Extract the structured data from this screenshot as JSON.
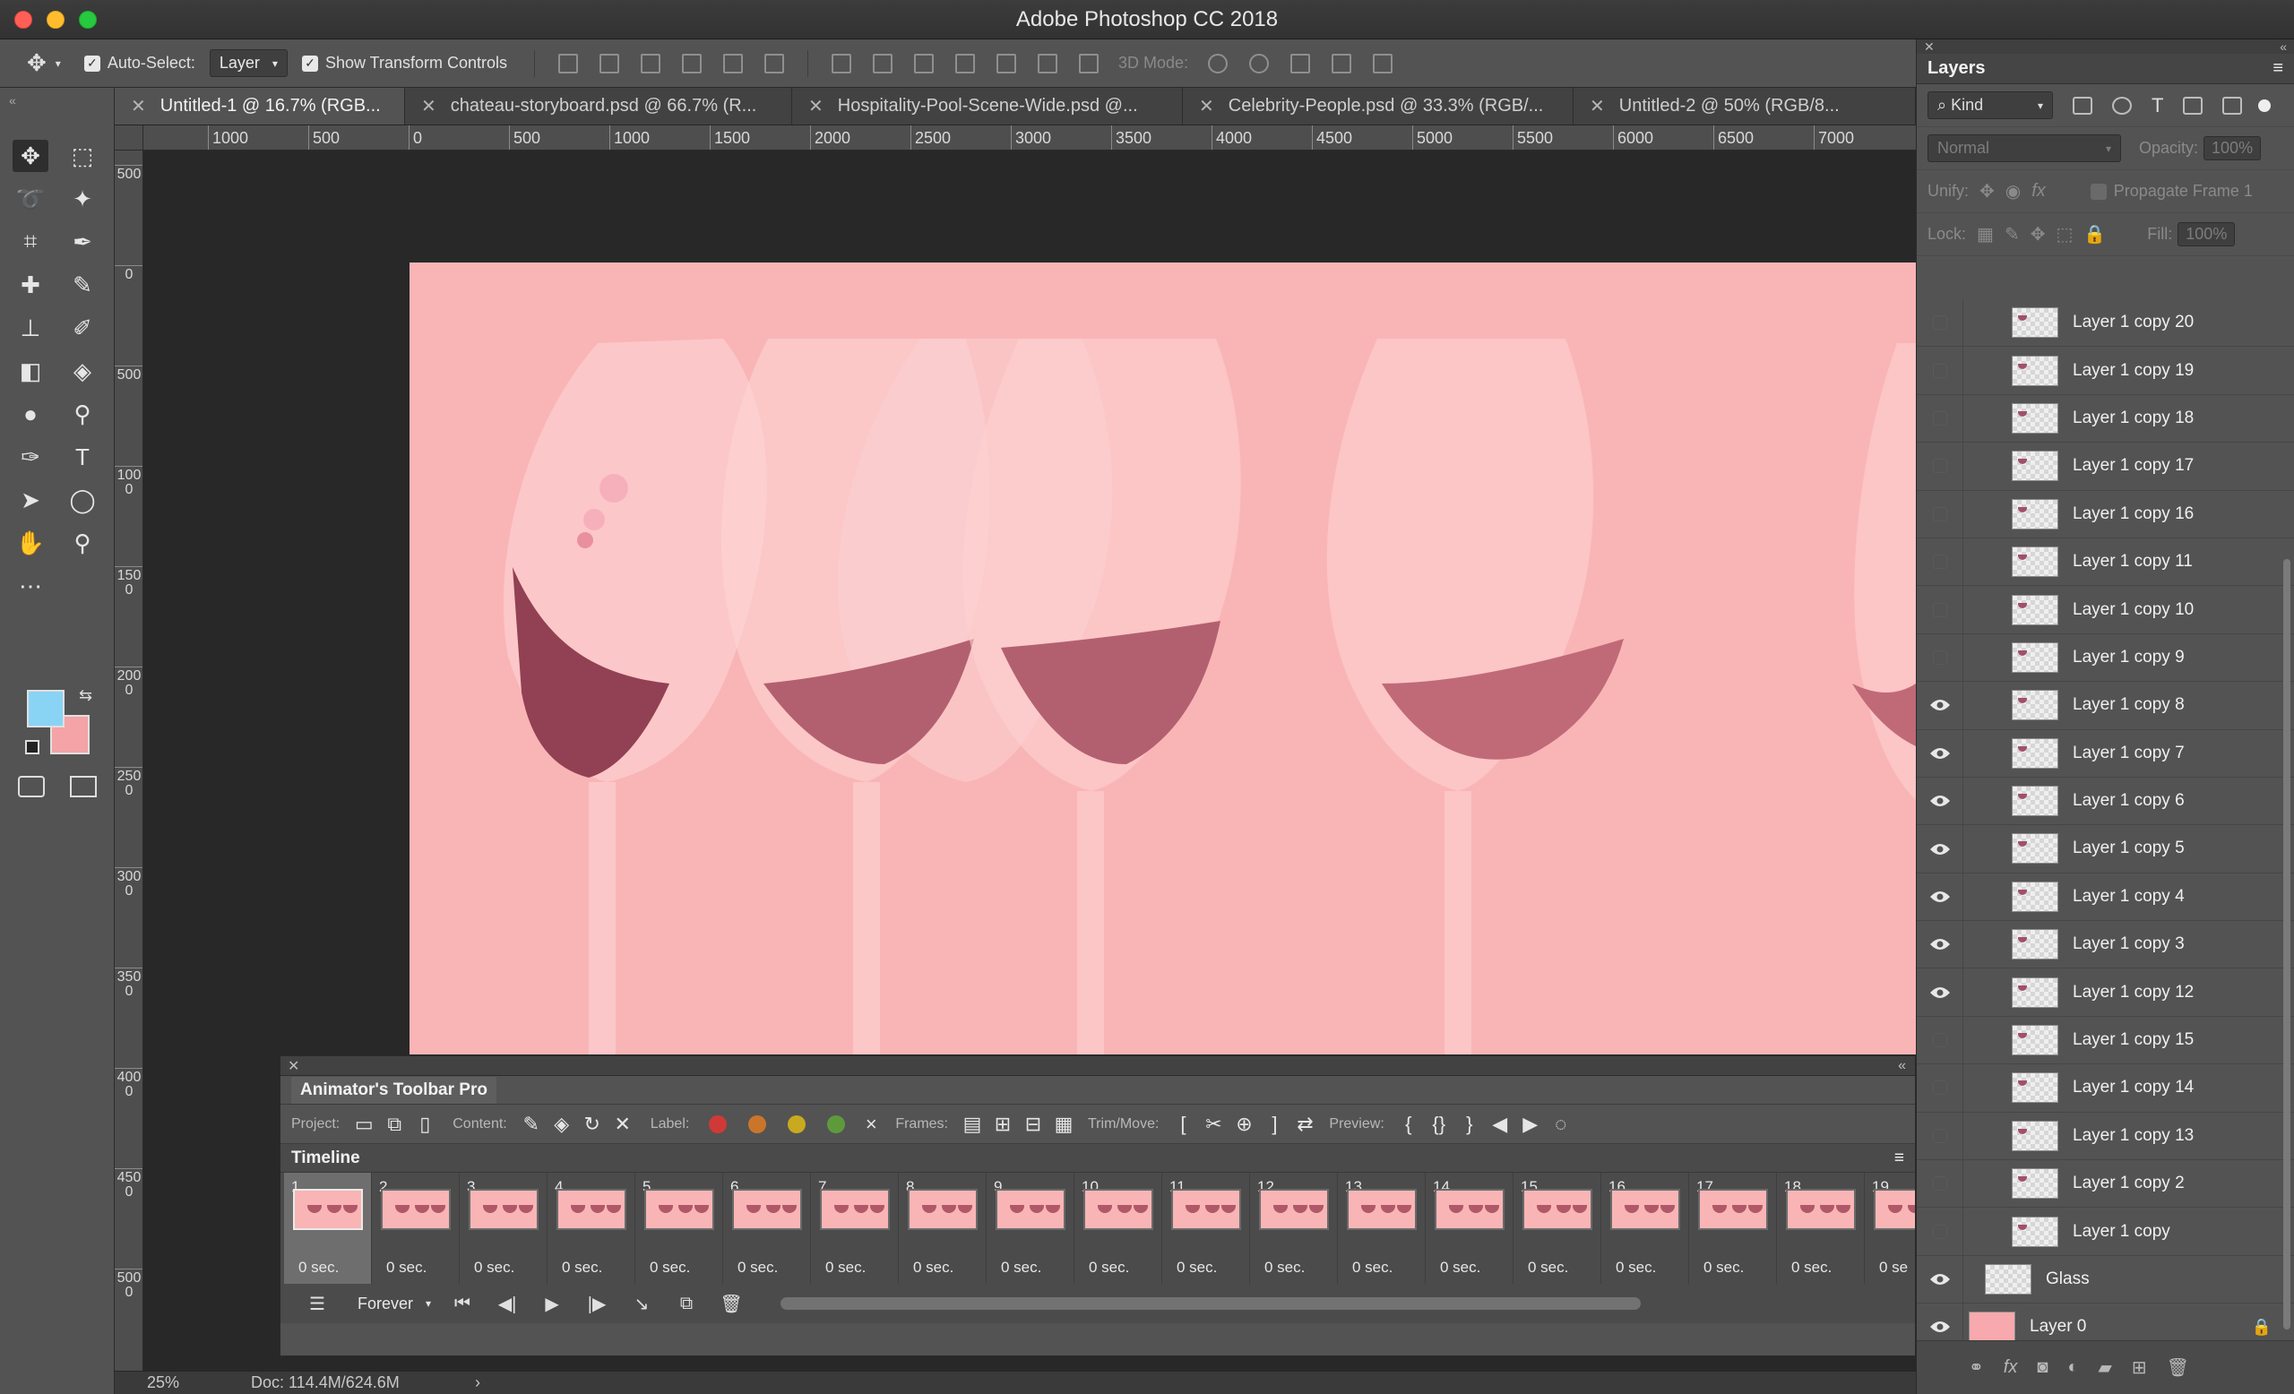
{
  "window": {
    "title": "Adobe Photoshop CC 2018"
  },
  "options_bar": {
    "auto_select_label": "Auto-Select:",
    "auto_select_value": "Layer",
    "show_transform_label": "Show Transform Controls",
    "mode_3d_label": "3D Mode:"
  },
  "tabs": [
    {
      "label": "Untitled-1 @ 16.7% (RGB..."
    },
    {
      "label": "chateau-storyboard.psd @ 66.7% (R..."
    },
    {
      "label": "Hospitality-Pool-Scene-Wide.psd @..."
    },
    {
      "label": "Celebrity-People.psd @ 33.3% (RGB/..."
    },
    {
      "label": "Untitled-2 @ 50% (RGB/8..."
    }
  ],
  "ruler_top": [
    "1000",
    "500",
    "0",
    "500",
    "1000",
    "1500",
    "2000",
    "2500",
    "3000",
    "3500",
    "4000",
    "4500",
    "5000",
    "5500",
    "6000",
    "6500",
    "7000"
  ],
  "ruler_left": [
    "500",
    "0",
    "500",
    "1000",
    "1500",
    "2000",
    "2500",
    "3000",
    "3500",
    "4000",
    "4500",
    "5000"
  ],
  "status": {
    "zoom": "25%",
    "doc": "Doc: 114.4M/624.6M"
  },
  "animator": {
    "title": "Animator's Toolbar Pro",
    "project_label": "Project:",
    "content_label": "Content:",
    "label_label": "Label:",
    "frames_label": "Frames:",
    "trim_label": "Trim/Move:",
    "preview_label": "Preview:",
    "label_colors": [
      "#d03a36",
      "#c9762a",
      "#c9a920",
      "#5e9a3c"
    ]
  },
  "timeline": {
    "title": "Timeline",
    "loop": "Forever",
    "frames": [
      {
        "num": "1",
        "dur": "0 sec."
      },
      {
        "num": "2",
        "dur": "0 sec."
      },
      {
        "num": "3",
        "dur": "0 sec."
      },
      {
        "num": "4",
        "dur": "0 sec."
      },
      {
        "num": "5",
        "dur": "0 sec."
      },
      {
        "num": "6",
        "dur": "0 sec."
      },
      {
        "num": "7",
        "dur": "0 sec."
      },
      {
        "num": "8",
        "dur": "0 sec."
      },
      {
        "num": "9",
        "dur": "0 sec."
      },
      {
        "num": "10",
        "dur": "0 sec."
      },
      {
        "num": "11",
        "dur": "0 sec."
      },
      {
        "num": "12",
        "dur": "0 sec."
      },
      {
        "num": "13",
        "dur": "0 sec."
      },
      {
        "num": "14",
        "dur": "0 sec."
      },
      {
        "num": "15",
        "dur": "0 sec."
      },
      {
        "num": "16",
        "dur": "0 sec."
      },
      {
        "num": "17",
        "dur": "0 sec."
      },
      {
        "num": "18",
        "dur": "0 sec."
      },
      {
        "num": "19",
        "dur": "0 se"
      }
    ]
  },
  "layers_panel": {
    "title": "Layers",
    "kind": "Kind",
    "blend_mode": "Normal",
    "opacity_label": "Opacity:",
    "opacity_value": "100%",
    "unify_label": "Unify:",
    "propagate_label": "Propagate Frame 1",
    "lock_label": "Lock:",
    "fill_label": "Fill:",
    "fill_value": "100%",
    "layers": [
      {
        "name": "Layer 1 copy 20",
        "visible": false
      },
      {
        "name": "Layer 1 copy 19",
        "visible": false
      },
      {
        "name": "Layer 1 copy 18",
        "visible": false
      },
      {
        "name": "Layer 1 copy 17",
        "visible": false
      },
      {
        "name": "Layer 1 copy 16",
        "visible": false
      },
      {
        "name": "Layer 1 copy 11",
        "visible": false
      },
      {
        "name": "Layer 1 copy 10",
        "visible": false
      },
      {
        "name": "Layer 1 copy 9",
        "visible": false
      },
      {
        "name": "Layer 1 copy 8",
        "visible": true
      },
      {
        "name": "Layer 1 copy 7",
        "visible": true
      },
      {
        "name": "Layer 1 copy 6",
        "visible": true
      },
      {
        "name": "Layer 1 copy 5",
        "visible": true
      },
      {
        "name": "Layer 1 copy 4",
        "visible": true
      },
      {
        "name": "Layer 1 copy 3",
        "visible": true
      },
      {
        "name": "Layer 1 copy 12",
        "visible": true
      },
      {
        "name": "Layer 1 copy 15",
        "visible": false
      },
      {
        "name": "Layer 1 copy 14",
        "visible": false
      },
      {
        "name": "Layer 1 copy 13",
        "visible": false
      },
      {
        "name": "Layer 1 copy 2",
        "visible": false
      },
      {
        "name": "Layer 1 copy",
        "visible": false
      },
      {
        "name": "Glass",
        "visible": true
      },
      {
        "name": "Layer 0",
        "visible": true
      }
    ]
  },
  "colors": {
    "foreground": "#89d4f5",
    "background": "#f4a3a6",
    "canvas": "#f9b5b6",
    "wine": "#8c3b4f"
  }
}
